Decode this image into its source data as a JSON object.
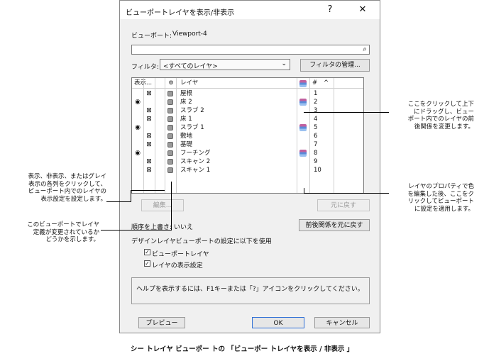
{
  "dialog": {
    "title": "ビューポートレイヤを表示/非表示",
    "help_btn": "?",
    "close_btn": "✕",
    "viewport_label": "ビューポート:",
    "viewport_name": "Viewport-4",
    "search_value": "",
    "filter_label": "フィルタ:",
    "filter_value": "<すべてのレイヤ>",
    "manage_filters_btn": "フィルタの管理..."
  },
  "table": {
    "headers": {
      "visibility": "表示...",
      "layer": "レイヤ",
      "number": "#",
      "sort_arrow": "^"
    },
    "rows": [
      {
        "vis": "x",
        "name": "屋根",
        "num": "1",
        "stack": false
      },
      {
        "vis": "eye",
        "name": "床 2",
        "num": "2",
        "stack": true
      },
      {
        "vis": "x",
        "name": "スラブ 2",
        "num": "3",
        "stack": false
      },
      {
        "vis": "x",
        "name": "床 1",
        "num": "4",
        "stack": false
      },
      {
        "vis": "eye",
        "name": "スラブ 1",
        "num": "5",
        "stack": true
      },
      {
        "vis": "x",
        "name": "敷地",
        "num": "6",
        "stack": false
      },
      {
        "vis": "x",
        "name": "基礎",
        "num": "7",
        "stack": false
      },
      {
        "vis": "eye",
        "name": "フーチング",
        "num": "8",
        "stack": true
      },
      {
        "vis": "x",
        "name": "スキャン 2",
        "num": "9",
        "stack": false
      },
      {
        "vis": "x",
        "name": "スキャン 1",
        "num": "10",
        "stack": false
      }
    ]
  },
  "buttons": {
    "edit": "編集...",
    "revert": "元に戻す",
    "revert_order": "前後関係を元に戻す",
    "preview": "プレビュー",
    "ok": "OK",
    "cancel": "キャンセル"
  },
  "order": {
    "label": "順序を上書き:",
    "value": "いいえ"
  },
  "design_layer": {
    "heading": "デザインレイヤビューポートの設定に以下を使用",
    "opt1": "ビューポートレイヤ",
    "opt2": "レイヤの表示設定"
  },
  "help_text": "ヘルプを表示するには、F1キーまたは「?」アイコンをクリックしてください。",
  "callouts": {
    "right1": [
      "ここをクリックして上下",
      "にドラッグし、ビュー",
      "ポート内でのレイヤの前",
      "後関係を変更します。"
    ],
    "right2": [
      "レイヤのプロパティで色",
      "を編集した後、ここをク",
      "リックしてビューポート",
      "に設定を適用します。"
    ],
    "left1": [
      "表示、非表示、またはグレイ",
      "表示の各列をクリックして、",
      "ビューポート内でのレイヤの",
      "表示設定を設定します。"
    ],
    "left2": [
      "このビューポートでレイヤ",
      "定義が変更されているか",
      "どうかを示します。"
    ]
  },
  "caption": "シー トレイヤ ビューポー トの 「ビューポー トレイヤを表示 / 非表示 」"
}
